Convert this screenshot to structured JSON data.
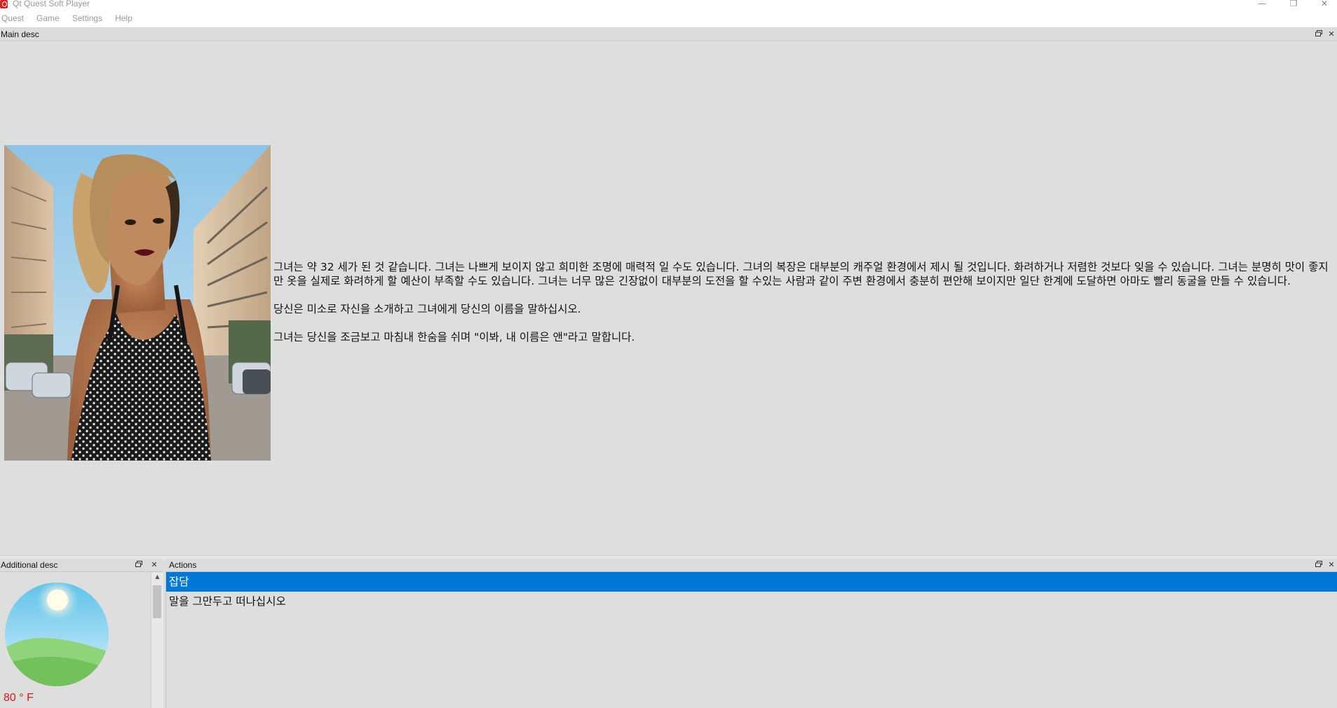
{
  "window": {
    "title": "Qt Quest Soft Player",
    "minimize_glyph": "—",
    "restore_glyph": "❐",
    "close_glyph": "✕"
  },
  "menu": [
    "Quest",
    "Game",
    "Settings",
    "Help"
  ],
  "main_desc": {
    "title": "Main desc",
    "paragraphs": [
      "그녀는 약 32 세가 된 것 같습니다. 그녀는 나쁘게 보이지 않고 희미한 조명에 매력적 일 수도 있습니다. 그녀의 복장은 대부분의 캐주얼 환경에서 제시 될 것입니다. 화려하거나 저렴한 것보다 잊을 수 있습니다. 그녀는 분명히 맛이 좋지만 옷을 실제로 화려하게 할 예산이 부족할 수도 있습니다. 그녀는 너무 많은 긴장없이 대부분의 도전을 할 수있는 사람과 같이 주변 환경에서 충분히 편안해 보이지만 일단 한계에 도달하면 아마도 빨리 동굴을 만들 수 있습니다.",
      "당신은 미소로 자신을 소개하고 그녀에게 당신의 이름을 말하십시오.",
      "그녀는 당신을 조금보고 마침내 한숨을 쉬며 \"이봐, 내 이름은 앤\"라고 말합니다."
    ]
  },
  "additional_desc": {
    "title": "Additional desc",
    "temperature": "80 ° F"
  },
  "actions": {
    "title": "Actions",
    "items": [
      "잡담",
      "말을 그만두고 떠나십시오"
    ],
    "selected_index": 0
  },
  "colors": {
    "selection": "#0078d7",
    "temperature_text": "#d11a1a",
    "panel_bg": "#dedede"
  },
  "icons": {
    "float": "float-icon",
    "close": "close-icon",
    "weather": "sunny-weather-icon"
  }
}
